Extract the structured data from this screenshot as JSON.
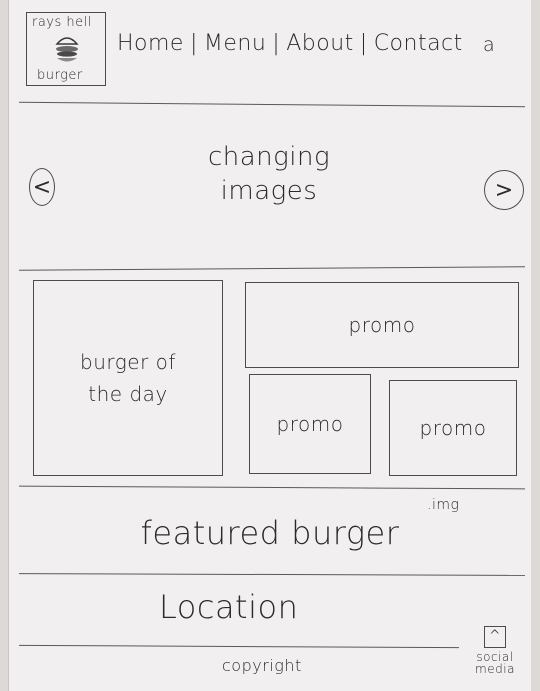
{
  "header": {
    "logo_line1": "rays hell",
    "logo_line2": "burger",
    "logo_icon": "burger-icon",
    "nav": [
      "Home",
      "Menu",
      "About",
      "Contact"
    ],
    "search_glyph": "a",
    "search_icon": "search-icon"
  },
  "hero": {
    "line1": "changing",
    "line2": "images",
    "prev_glyph": "<",
    "next_glyph": ">"
  },
  "grid": {
    "burger_of_day_line1": "burger of",
    "burger_of_day_line2": "the day",
    "promo_wide": "promo",
    "promo_a": "promo",
    "promo_b": "promo",
    "img_note": ".img"
  },
  "featured": "featured burger",
  "location": "Location",
  "footer": {
    "copyright": "copyright",
    "social_glyph": "^",
    "social_line1": "social",
    "social_line2": "media"
  }
}
